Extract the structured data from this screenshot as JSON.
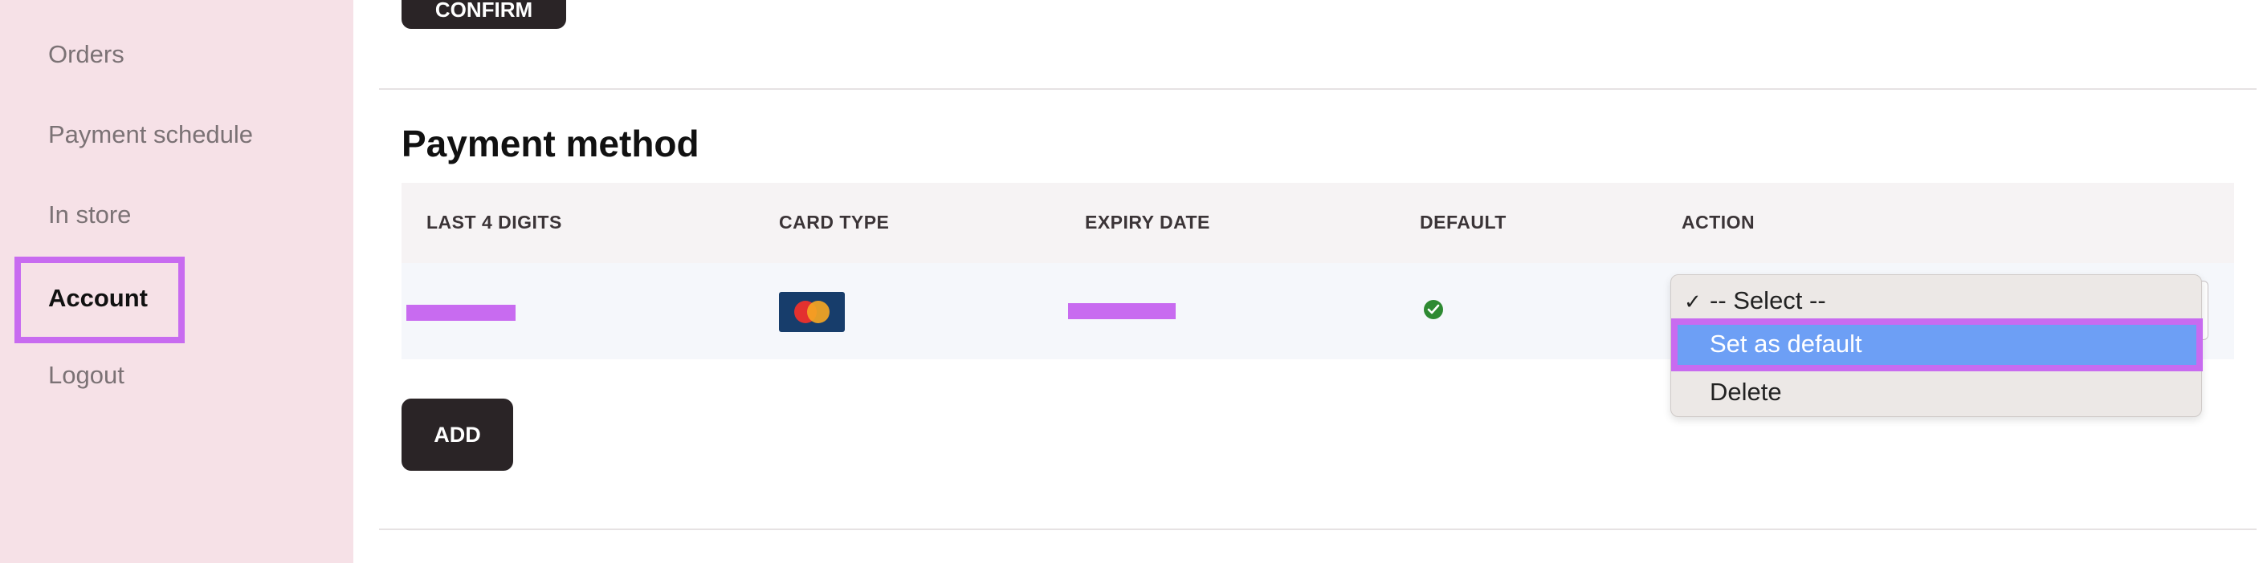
{
  "sidebar": {
    "items": [
      {
        "label": "Orders"
      },
      {
        "label": "Payment schedule"
      },
      {
        "label": "In store"
      },
      {
        "label": "Account"
      },
      {
        "label": "Logout"
      }
    ]
  },
  "top_button": {
    "label": "CONFIRM"
  },
  "payment": {
    "title": "Payment method",
    "columns": [
      "LAST 4 DIGITS",
      "CARD TYPE",
      "EXPIRY DATE",
      "DEFAULT",
      "ACTION"
    ],
    "row": {
      "card_type_icon": "mastercard-icon",
      "default_icon": "check-circle-icon",
      "action": {
        "selected": "-- Select --",
        "options": [
          "-- Select --",
          "Set as default",
          "Delete"
        ]
      }
    },
    "add_label": "ADD"
  },
  "colors": {
    "sidebar_bg": "#f6e1e7",
    "highlight": "#c86bf0",
    "button_bg": "#2a2426",
    "selected_option_bg": "#6d9ff5",
    "default_check": "#2e8a32"
  }
}
